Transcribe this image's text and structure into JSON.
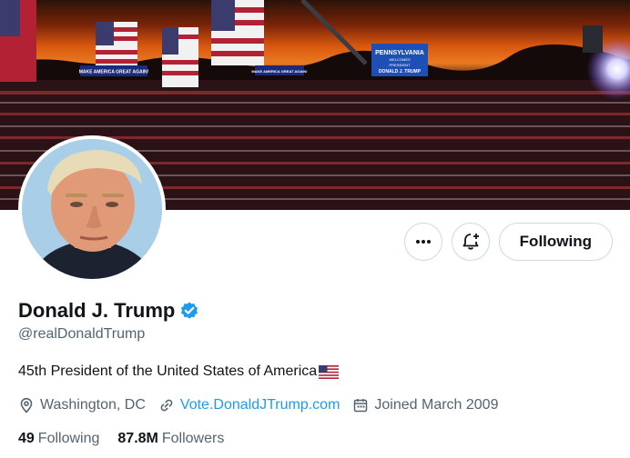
{
  "banner": {
    "image": "rally-crowd-sunset",
    "signs": [
      "MAKE AMERICA GREAT AGAIN!",
      "MAKE AMERICA GREAT AGAIN!",
      "PENNSYLVANIA",
      "WELCOMES",
      "PRESIDENT",
      "DONALD J. TRUMP"
    ]
  },
  "avatar": {
    "image": "profile-photo"
  },
  "actions": {
    "more_icon": "more-horizontal-icon",
    "notify_icon": "bell-plus-icon",
    "follow_label": "Following"
  },
  "profile": {
    "display_name": "Donald J. Trump",
    "verified": true,
    "verified_color": "#1d9bf0",
    "handle": "@realDonaldTrump",
    "bio": "45th President of the United States of America",
    "bio_emoji": "us-flag-icon",
    "location": "Washington, DC",
    "website": "Vote.DonaldJTrump.com",
    "joined": "Joined March 2009"
  },
  "stats": {
    "following_count": "49",
    "following_label": "Following",
    "followers_count": "87.8M",
    "followers_label": "Followers"
  },
  "colors": {
    "accent": "#1d9bf0",
    "text": "#0f1419",
    "muted": "#536471",
    "border": "#cfd9de"
  }
}
